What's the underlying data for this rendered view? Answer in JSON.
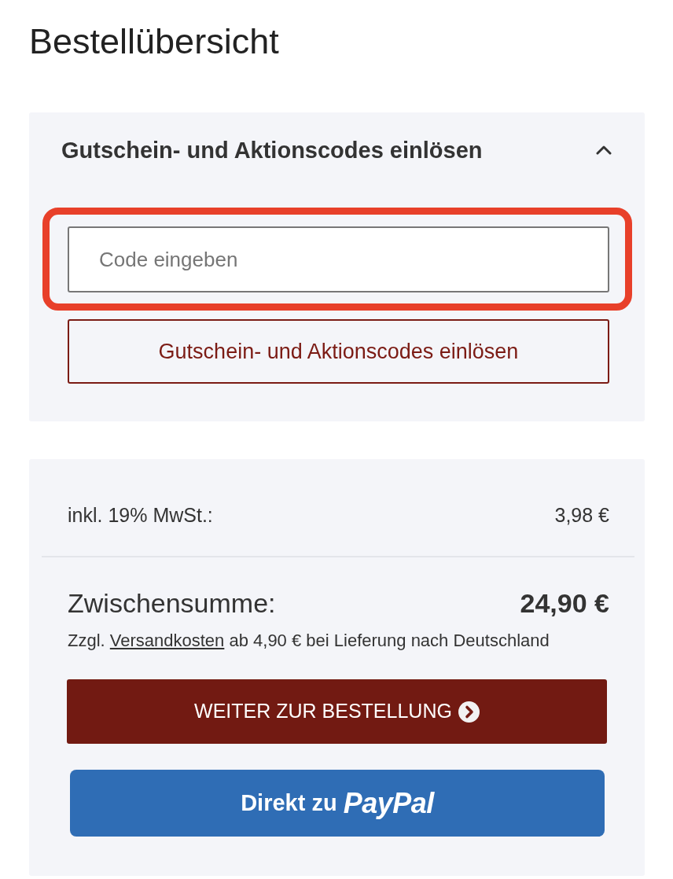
{
  "page": {
    "title": "Bestellübersicht"
  },
  "coupon": {
    "heading": "Gutschein- und Aktionscodes einlösen",
    "expanded": true,
    "code_field": {
      "placeholder": "Code eingeben",
      "highlighted": true
    },
    "apply_button": "Gutschein- und Aktionscodes einlösen"
  },
  "summary": {
    "rows": [
      {
        "kind": "tax",
        "label": "inkl. 19% MwSt.:",
        "value": "3,98 €"
      },
      {
        "kind": "subtotal",
        "label": "Zwischensumme:",
        "value": "24,90 €"
      }
    ],
    "shipping_note": {
      "before": "Zzgl.",
      "link": "Versandkosten",
      "after": "ab 4,90 € bei Lieferung nach Deutschland"
    },
    "checkout_button": "WEITER ZUR BESTELLUNG",
    "paypal_button": {
      "label": "Direkt zu",
      "brand": "PayPal"
    }
  }
}
